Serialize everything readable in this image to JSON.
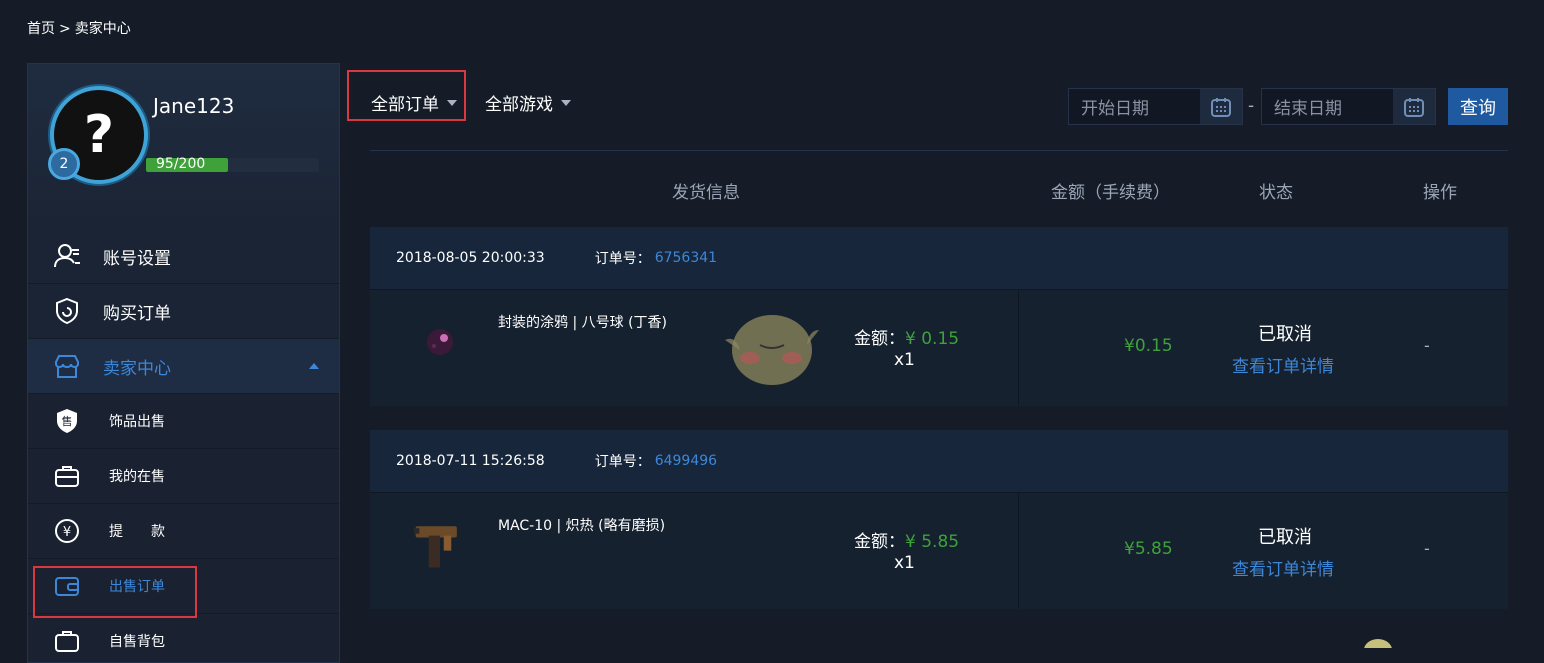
{
  "breadcrumb": {
    "home": "首页",
    "sep": ">",
    "current": "卖家中心"
  },
  "profile": {
    "username": "Jane123",
    "level": "2",
    "xp_current": "95",
    "xp_total": "/200",
    "xp_fraction": 0.475,
    "avatar_glyph": "?"
  },
  "menu": [
    {
      "label": "账号设置",
      "icon": "user-settings-icon"
    },
    {
      "label": "购买订单",
      "icon": "shield-icon"
    },
    {
      "label": "卖家中心",
      "icon": "store-icon"
    },
    {
      "label": "饰品出售",
      "icon": "sell-badge-icon"
    },
    {
      "label": "我的在售",
      "icon": "briefcase-icon"
    },
    {
      "label": "提　　款",
      "icon": "yuan-icon"
    },
    {
      "label": "出售订单",
      "icon": "wallet-icon"
    },
    {
      "label": "自售背包",
      "icon": "bag-icon"
    }
  ],
  "filters": {
    "orders": "全部订单",
    "games": "全部游戏"
  },
  "date": {
    "start_placeholder": "开始日期",
    "end_placeholder": "结束日期",
    "sep": "-"
  },
  "query_label": "查询",
  "table_headers": {
    "ship_info": "发货信息",
    "amount": "金额（手续费）",
    "status": "状态",
    "action": "操作"
  },
  "orders": [
    {
      "date": "2018-08-05 20:00:33",
      "order_label": "订单号：",
      "order_no": "6756341",
      "item_name": "封装的涂鸦 | 八号球 (丁香)",
      "amount_label": "金额：",
      "amount": "¥ 0.15",
      "qty": "x1",
      "fee": "¥0.15",
      "status": "已取消",
      "detail": "查看订单详情",
      "op": "-"
    },
    {
      "date": "2018-07-11 15:26:58",
      "order_label": "订单号：",
      "order_no": "6499496",
      "item_name": "MAC-10 | 炽热 (略有磨损)",
      "amount_label": "金额：",
      "amount": "¥ 5.85",
      "qty": "x1",
      "fee": "¥5.85",
      "status": "已取消",
      "detail": "查看订单详情",
      "op": "-"
    }
  ],
  "colors": {
    "accent": "#3d87d9",
    "green": "#3ea13a",
    "highlight": "#d9383e",
    "bg": "#151c27"
  }
}
